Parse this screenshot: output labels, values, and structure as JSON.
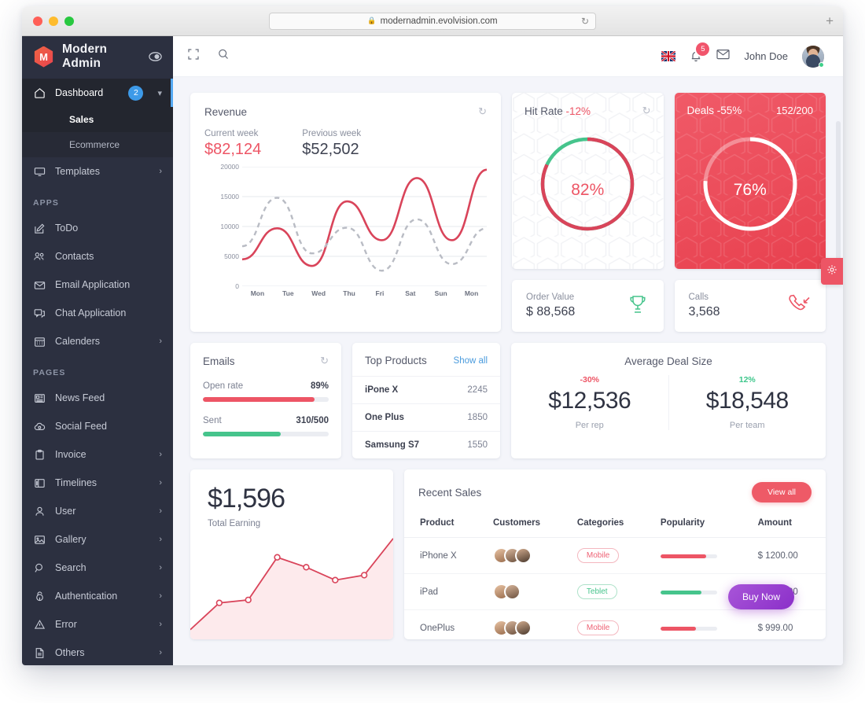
{
  "browser": {
    "url": "modernadmin.evolvision.com",
    "lock_icon": "lock-icon",
    "reload_icon": "reload-icon",
    "new_tab_label": "+"
  },
  "sidebar": {
    "brand": "Modern Admin",
    "logo_letter": "M",
    "logo_color": "#ed5565",
    "toggle_icon": "eye-icon",
    "items": [
      {
        "label": "Dashboard",
        "icon": "home-icon",
        "badge": "2",
        "chevron": "chevron-down-icon",
        "active": true
      },
      {
        "label": "Templates",
        "icon": "monitor-icon",
        "chevron": "chevron-right-icon"
      },
      {
        "label": "ToDo",
        "icon": "edit-square-icon"
      },
      {
        "label": "Contacts",
        "icon": "users-icon"
      },
      {
        "label": "Email Application",
        "icon": "mail-icon"
      },
      {
        "label": "Chat Application",
        "icon": "chat-icon"
      },
      {
        "label": "Calenders",
        "icon": "calendar-icon",
        "chevron": "chevron-right-icon"
      },
      {
        "label": "News Feed",
        "icon": "newspaper-icon"
      },
      {
        "label": "Social Feed",
        "icon": "cloud-icon"
      },
      {
        "label": "Invoice",
        "icon": "clipboard-icon",
        "chevron": "chevron-right-icon"
      },
      {
        "label": "Timelines",
        "icon": "timeline-icon",
        "chevron": "chevron-right-icon"
      },
      {
        "label": "User",
        "icon": "user-icon",
        "chevron": "chevron-right-icon"
      },
      {
        "label": "Gallery",
        "icon": "image-icon",
        "chevron": "chevron-right-icon"
      },
      {
        "label": "Search",
        "icon": "search-icon",
        "chevron": "chevron-right-icon"
      },
      {
        "label": "Authentication",
        "icon": "lock-icon",
        "chevron": "chevron-right-icon"
      },
      {
        "label": "Error",
        "icon": "warning-icon",
        "chevron": "chevron-right-icon"
      },
      {
        "label": "Others",
        "icon": "file-icon",
        "chevron": "chevron-right-icon"
      }
    ],
    "submenu": [
      {
        "label": "Sales",
        "current": true
      },
      {
        "label": "Ecommerce",
        "current": false
      }
    ],
    "sections": [
      {
        "label": "APPS"
      },
      {
        "label": "PAGES"
      }
    ]
  },
  "topbar": {
    "expand_icon": "fullscreen-icon",
    "search_icon": "search-icon",
    "flag_icon": "uk-flag-icon",
    "bell_icon": "bell-icon",
    "bell_badge": "5",
    "mail_icon": "envelope-icon",
    "username": "John Doe",
    "avatar_icon": "avatar"
  },
  "settings_tab": {
    "icon": "gear-icon"
  },
  "revenue": {
    "title": "Revenue",
    "refresh_icon": "refresh-icon",
    "current_week_label": "Current week",
    "current_week_value": "$82,124",
    "previous_week_label": "Previous week",
    "previous_week_value": "$52,502"
  },
  "hit_rate": {
    "title": "Hit Rate",
    "delta": "-12%",
    "refresh_icon": "refresh-icon",
    "value": "82%"
  },
  "deals": {
    "title": "Deals",
    "delta": "-55%",
    "ratio": "152/200",
    "value": "76%"
  },
  "order_value": {
    "label": "Order Value",
    "value": "$ 88,568",
    "icon": "trophy-icon"
  },
  "calls": {
    "label": "Calls",
    "value": "3,568",
    "icon": "phone-incoming-icon"
  },
  "emails": {
    "title": "Emails",
    "refresh_icon": "refresh-icon",
    "rows": [
      {
        "label": "Open rate",
        "value": "89%",
        "pct": 89,
        "color": "#ed5565"
      },
      {
        "label": "Sent",
        "value": "310/500",
        "pct": 62,
        "color": "#46c48c"
      }
    ]
  },
  "top_products": {
    "title": "Top Products",
    "show_all": "Show all",
    "rows": [
      {
        "name": "iPone X",
        "count": "2245"
      },
      {
        "name": "One Plus",
        "count": "1850"
      },
      {
        "name": "Samsung S7",
        "count": "1550"
      }
    ]
  },
  "average_deal_size": {
    "title": "Average Deal Size",
    "halves": [
      {
        "pct": "-30%",
        "amount": "$12,536",
        "sub": "Per rep",
        "trend": "neg"
      },
      {
        "pct": "12%",
        "amount": "$18,548",
        "sub": "Per team",
        "trend": "pos"
      }
    ]
  },
  "total_earning": {
    "amount": "$1,596",
    "label": "Total Earning"
  },
  "recent_sales": {
    "title": "Recent Sales",
    "view_all": "View all",
    "buy_now": "Buy Now",
    "columns": [
      "Product",
      "Customers",
      "Categories",
      "Popularity",
      "Amount"
    ],
    "rows": [
      {
        "product": "iPhone X",
        "customers": 3,
        "category": "Mobile",
        "category_type": "mobile",
        "popularity": 80,
        "popularity_color": "#ed5565",
        "amount": "$ 1200.00"
      },
      {
        "product": "iPad",
        "customers": 2,
        "category": "Teblet",
        "category_type": "teblet",
        "popularity": 72,
        "popularity_color": "#46c48c",
        "amount": "$ 1400.00"
      },
      {
        "product": "OnePlus",
        "customers": 3,
        "category": "Mobile",
        "category_type": "mobile",
        "popularity": 62,
        "popularity_color": "#ed5565",
        "amount": "$ 999.00"
      }
    ]
  },
  "chart_data": [
    {
      "type": "line",
      "title": "Revenue",
      "xlabel": "",
      "ylabel": "",
      "categories": [
        "Mon",
        "Tue",
        "Wed",
        "Thu",
        "Fri",
        "Sat",
        "Sun",
        "Mon"
      ],
      "ylim": [
        0,
        20000
      ],
      "yticks": [
        0,
        5000,
        10000,
        15000,
        20000
      ],
      "grid": true,
      "legend": "none",
      "series": [
        {
          "name": "Current week",
          "color": "#d9445a",
          "style": "solid",
          "values": [
            4500,
            9700,
            3400,
            14200,
            7700,
            18100,
            7700,
            19500
          ]
        },
        {
          "name": "Previous week",
          "color": "#b9bcc4",
          "style": "dashed",
          "values": [
            6700,
            14800,
            5500,
            9800,
            2600,
            11200,
            3700,
            9700
          ]
        }
      ]
    },
    {
      "type": "pie",
      "title": "Hit Rate",
      "subtitle": "-12%",
      "center_label": "82%",
      "slices": [
        {
          "name": "achieved",
          "value": 82,
          "color": "#d9445a"
        },
        {
          "name": "remaining",
          "value": 18,
          "color": "#46c48c"
        }
      ]
    },
    {
      "type": "pie",
      "title": "Deals",
      "subtitle": "-55%",
      "center_label": "76%",
      "slices": [
        {
          "name": "achieved",
          "value": 76,
          "color": "#ffffff"
        },
        {
          "name": "remaining",
          "value": 24,
          "color": "#f08592"
        }
      ]
    },
    {
      "type": "bar",
      "title": "Emails",
      "categories": [
        "Open rate",
        "Sent"
      ],
      "values": [
        89,
        62
      ],
      "ylim": [
        0,
        100
      ]
    },
    {
      "type": "area",
      "title": "Total Earning",
      "annotation": "$1,596",
      "x": [
        0,
        1,
        2,
        3,
        4,
        5,
        6,
        7
      ],
      "values": [
        5,
        32,
        35,
        78,
        68,
        55,
        60,
        97
      ],
      "color": "#d9445a",
      "ylim": [
        0,
        100
      ],
      "grid": false
    },
    {
      "type": "bar",
      "title": "Recent Sales Popularity",
      "categories": [
        "iPhone X",
        "iPad",
        "OnePlus"
      ],
      "values": [
        80,
        72,
        62
      ],
      "ylim": [
        0,
        100
      ]
    }
  ]
}
